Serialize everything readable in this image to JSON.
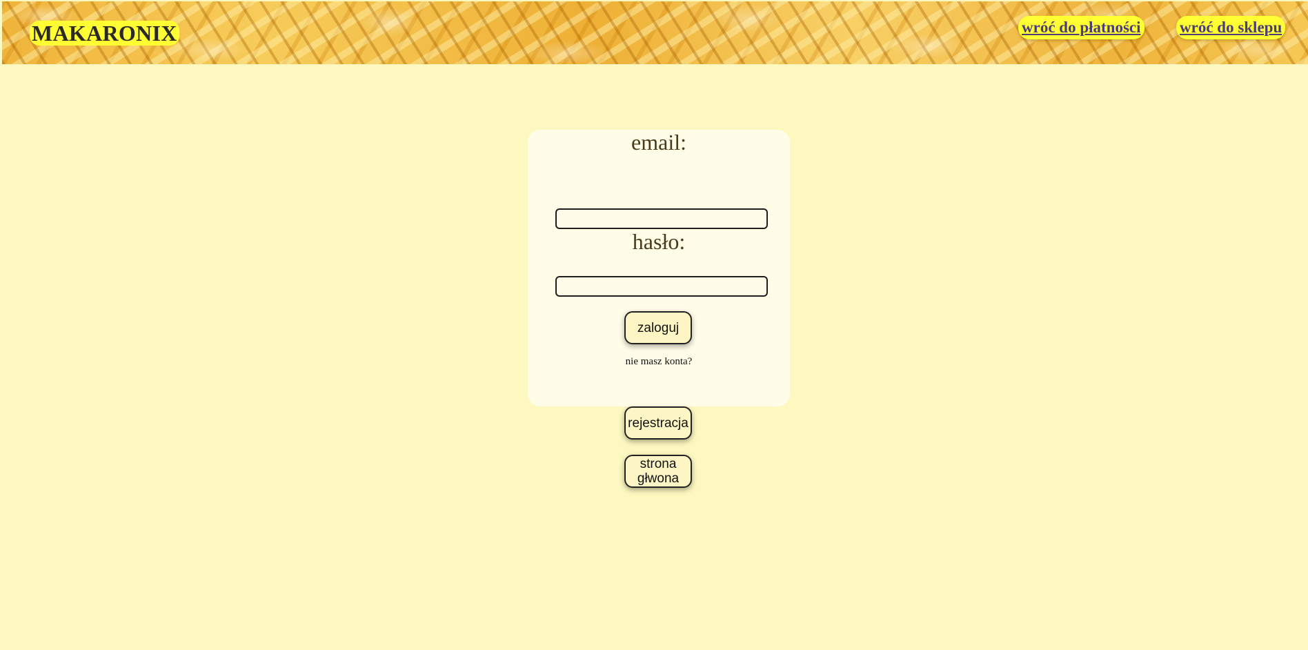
{
  "header": {
    "logo": "MAKARONIX",
    "nav": {
      "back_to_payment": "wróć do płatności",
      "back_to_shop": "wróć do sklepu"
    }
  },
  "login_form": {
    "email_label": "email:",
    "email_value": "",
    "password_label": "hasło:",
    "password_value": "",
    "login_button": "zaloguj",
    "no_account_text": "nie masz konta?"
  },
  "actions": {
    "register_button": "rejestracja",
    "home_button": "strona głwona"
  },
  "colors": {
    "page_background": "#fdf8c0",
    "card_background": "#fffde8",
    "highlight_yellow": "#ffff33",
    "link_color": "#4a3d78"
  }
}
